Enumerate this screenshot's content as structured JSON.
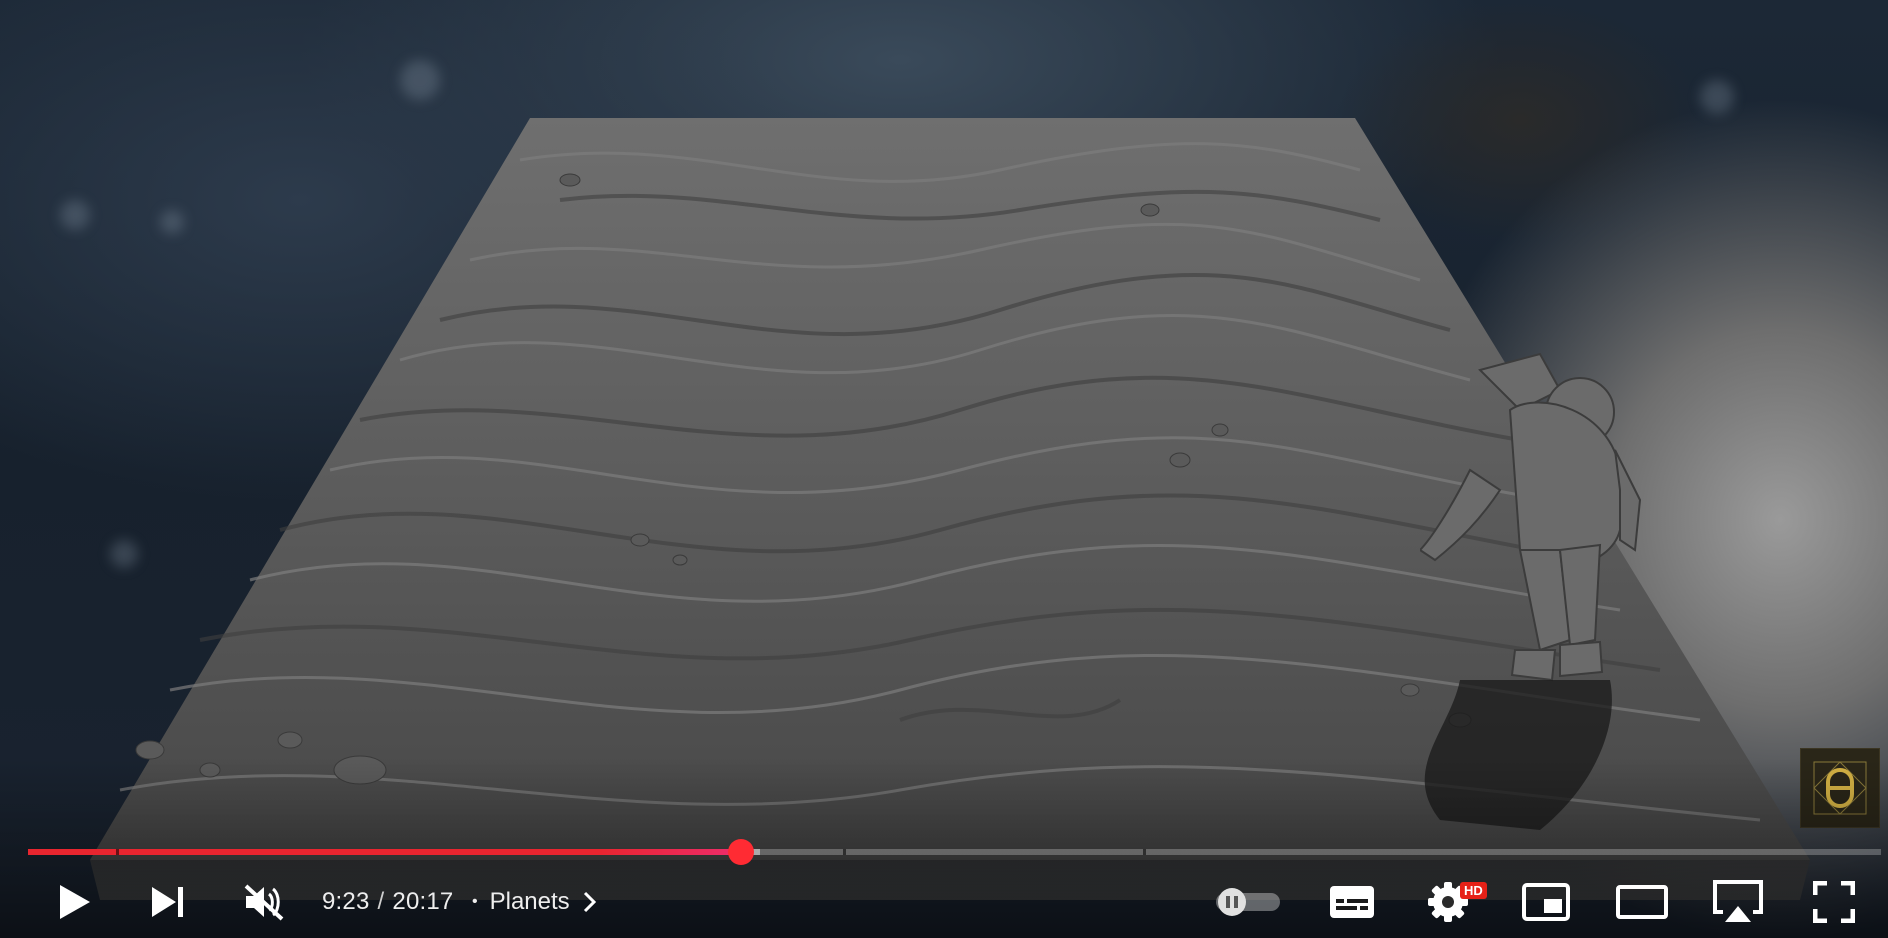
{
  "player": {
    "current_time": "9:23",
    "time_separator": "/",
    "duration": "20:17",
    "chapter_separator": "•",
    "chapter_title": "Planets",
    "progress_played_fraction": 0.385,
    "progress_loaded_fraction": 0.395,
    "colors": {
      "progress_played": "#e8252f",
      "scrubber": "#ff2b33",
      "hd_badge": "#e62117",
      "control_icons": "#ffffff"
    },
    "hd_badge": "HD",
    "icons": {
      "play": "play-icon",
      "next": "next-icon",
      "mute": "volume-muted-icon",
      "chapter": "chevron-right-icon",
      "autoplay": "autoplay-toggle-icon",
      "captions": "subtitles-icon",
      "settings": "gear-icon",
      "miniplayer": "miniplayer-icon",
      "theater": "theater-mode-icon",
      "cast": "airplay-icon",
      "fullscreen": "fullscreen-icon",
      "watermark": "channel-logo-icon"
    }
  }
}
